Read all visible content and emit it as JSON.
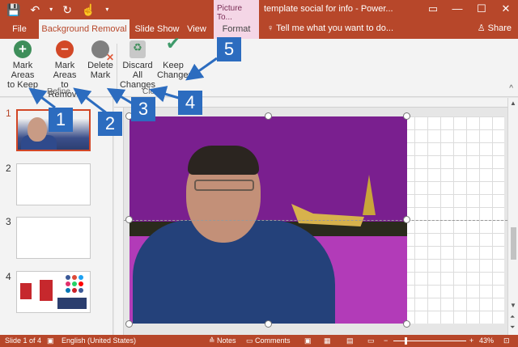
{
  "titlebar": {
    "undo_icon": "↶",
    "redo_icon": "↻",
    "touch_icon": "☝",
    "dropdown_icon": "▾",
    "context_tab_header": "Picture To...",
    "doc_title": "template social for info - Power...",
    "controls": [
      "▭",
      "—",
      "☐",
      "✕"
    ]
  },
  "tabs": {
    "file": "File",
    "active": "Background Removal",
    "slideshow": "Slide Show",
    "view": "View",
    "format": "Format",
    "tell_me": "Tell me what you want to do...",
    "share": "Share"
  },
  "ribbon": {
    "mark_keep": "Mark Areas to Keep",
    "mark_keep_l1": "Mark Areas",
    "mark_keep_l2": "to Keep",
    "mark_remove_l1": "Mark Areas",
    "mark_remove_l2": "to Remove",
    "delete_l1": "Delete",
    "delete_l2": "Mark",
    "discard_l1": "Discard All",
    "discard_l2": "Changes",
    "keep_l1": "Keep",
    "keep_l2": "Changes",
    "group_refine": "Refine",
    "group_close": "Close",
    "collapse_icon": "^"
  },
  "slides": [
    "1",
    "2",
    "3",
    "4"
  ],
  "callouts": [
    "1",
    "2",
    "3",
    "4",
    "5"
  ],
  "scroll": {
    "up": "▲",
    "down": "▼",
    "page_up": "⏶",
    "page_down": "⏷"
  },
  "status": {
    "slide": "Slide 1 of 4",
    "language": "English (United States)",
    "notes": "Notes",
    "comments": "Comments",
    "zoom_minus": "−",
    "zoom_plus": "+",
    "zoom": "43%"
  },
  "colors": {
    "accent": "#b7472a",
    "callout": "#2c6cbf",
    "removed_area": "#b23bb8"
  }
}
